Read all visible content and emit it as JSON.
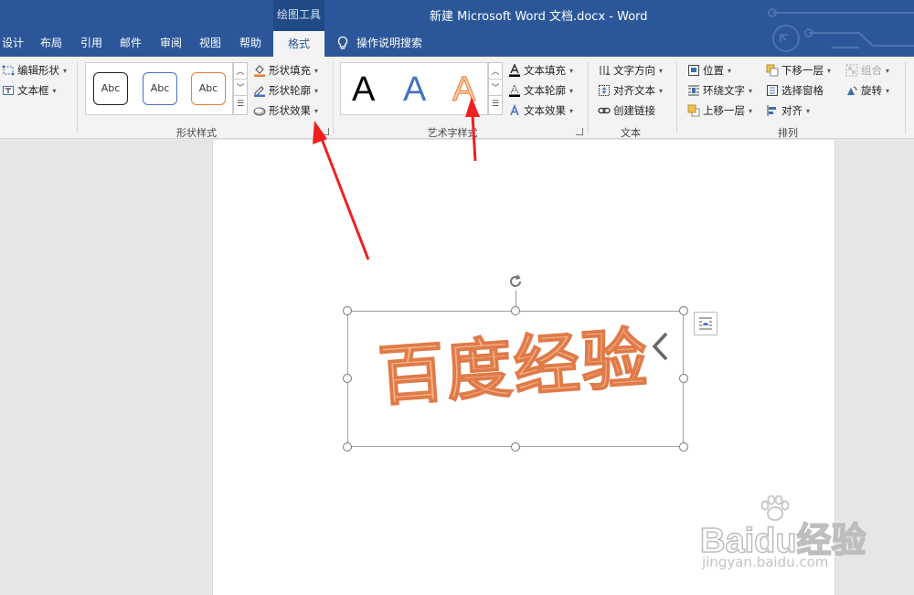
{
  "title": {
    "tool_group": "绘图工具",
    "document": "新建 Microsoft Word 文档.docx  -  Word"
  },
  "tabs": [
    {
      "label": "设计"
    },
    {
      "label": "布局"
    },
    {
      "label": "引用"
    },
    {
      "label": "邮件"
    },
    {
      "label": "审阅"
    },
    {
      "label": "视图"
    },
    {
      "label": "帮助"
    },
    {
      "label": "格式",
      "active": true
    }
  ],
  "tell_me": {
    "label": "操作说明搜索",
    "icon": "lightbulb-icon"
  },
  "ribbon": {
    "insert_shapes": {
      "edit_shape": "编辑形状",
      "text_box": "文本框"
    },
    "shape_styles": {
      "label": "形状样式",
      "gallery": [
        "Abc",
        "Abc",
        "Abc"
      ],
      "fill": "形状填充",
      "outline": "形状轮廓",
      "effects": "形状效果"
    },
    "wordart_styles": {
      "label": "艺术字样式",
      "gallery": [
        "A",
        "A",
        "A"
      ],
      "text_fill": "文本填充",
      "text_outline": "文本轮廓",
      "text_effects": "文本效果"
    },
    "text": {
      "label": "文本",
      "direction": "文字方向",
      "align": "对齐文本",
      "link": "创建链接"
    },
    "arrange": {
      "label": "排列",
      "position": "位置",
      "wrap": "环绕文字",
      "forward": "上移一层",
      "backward": "下移一层",
      "selection_pane": "选择窗格",
      "align": "对齐",
      "group": "组合",
      "rotate": "旋转"
    }
  },
  "document": {
    "wordart_text": "百度经验"
  },
  "watermark": {
    "brand": "Baidu经验",
    "url": "jingyan.baidu.com"
  },
  "colors": {
    "title_bar": "#2b579a",
    "ribbon": "#f3f3f3",
    "wordart_fill": "#f5b389",
    "wordart_outline": "#e07a48",
    "annotation_arrow": "#f02020"
  }
}
